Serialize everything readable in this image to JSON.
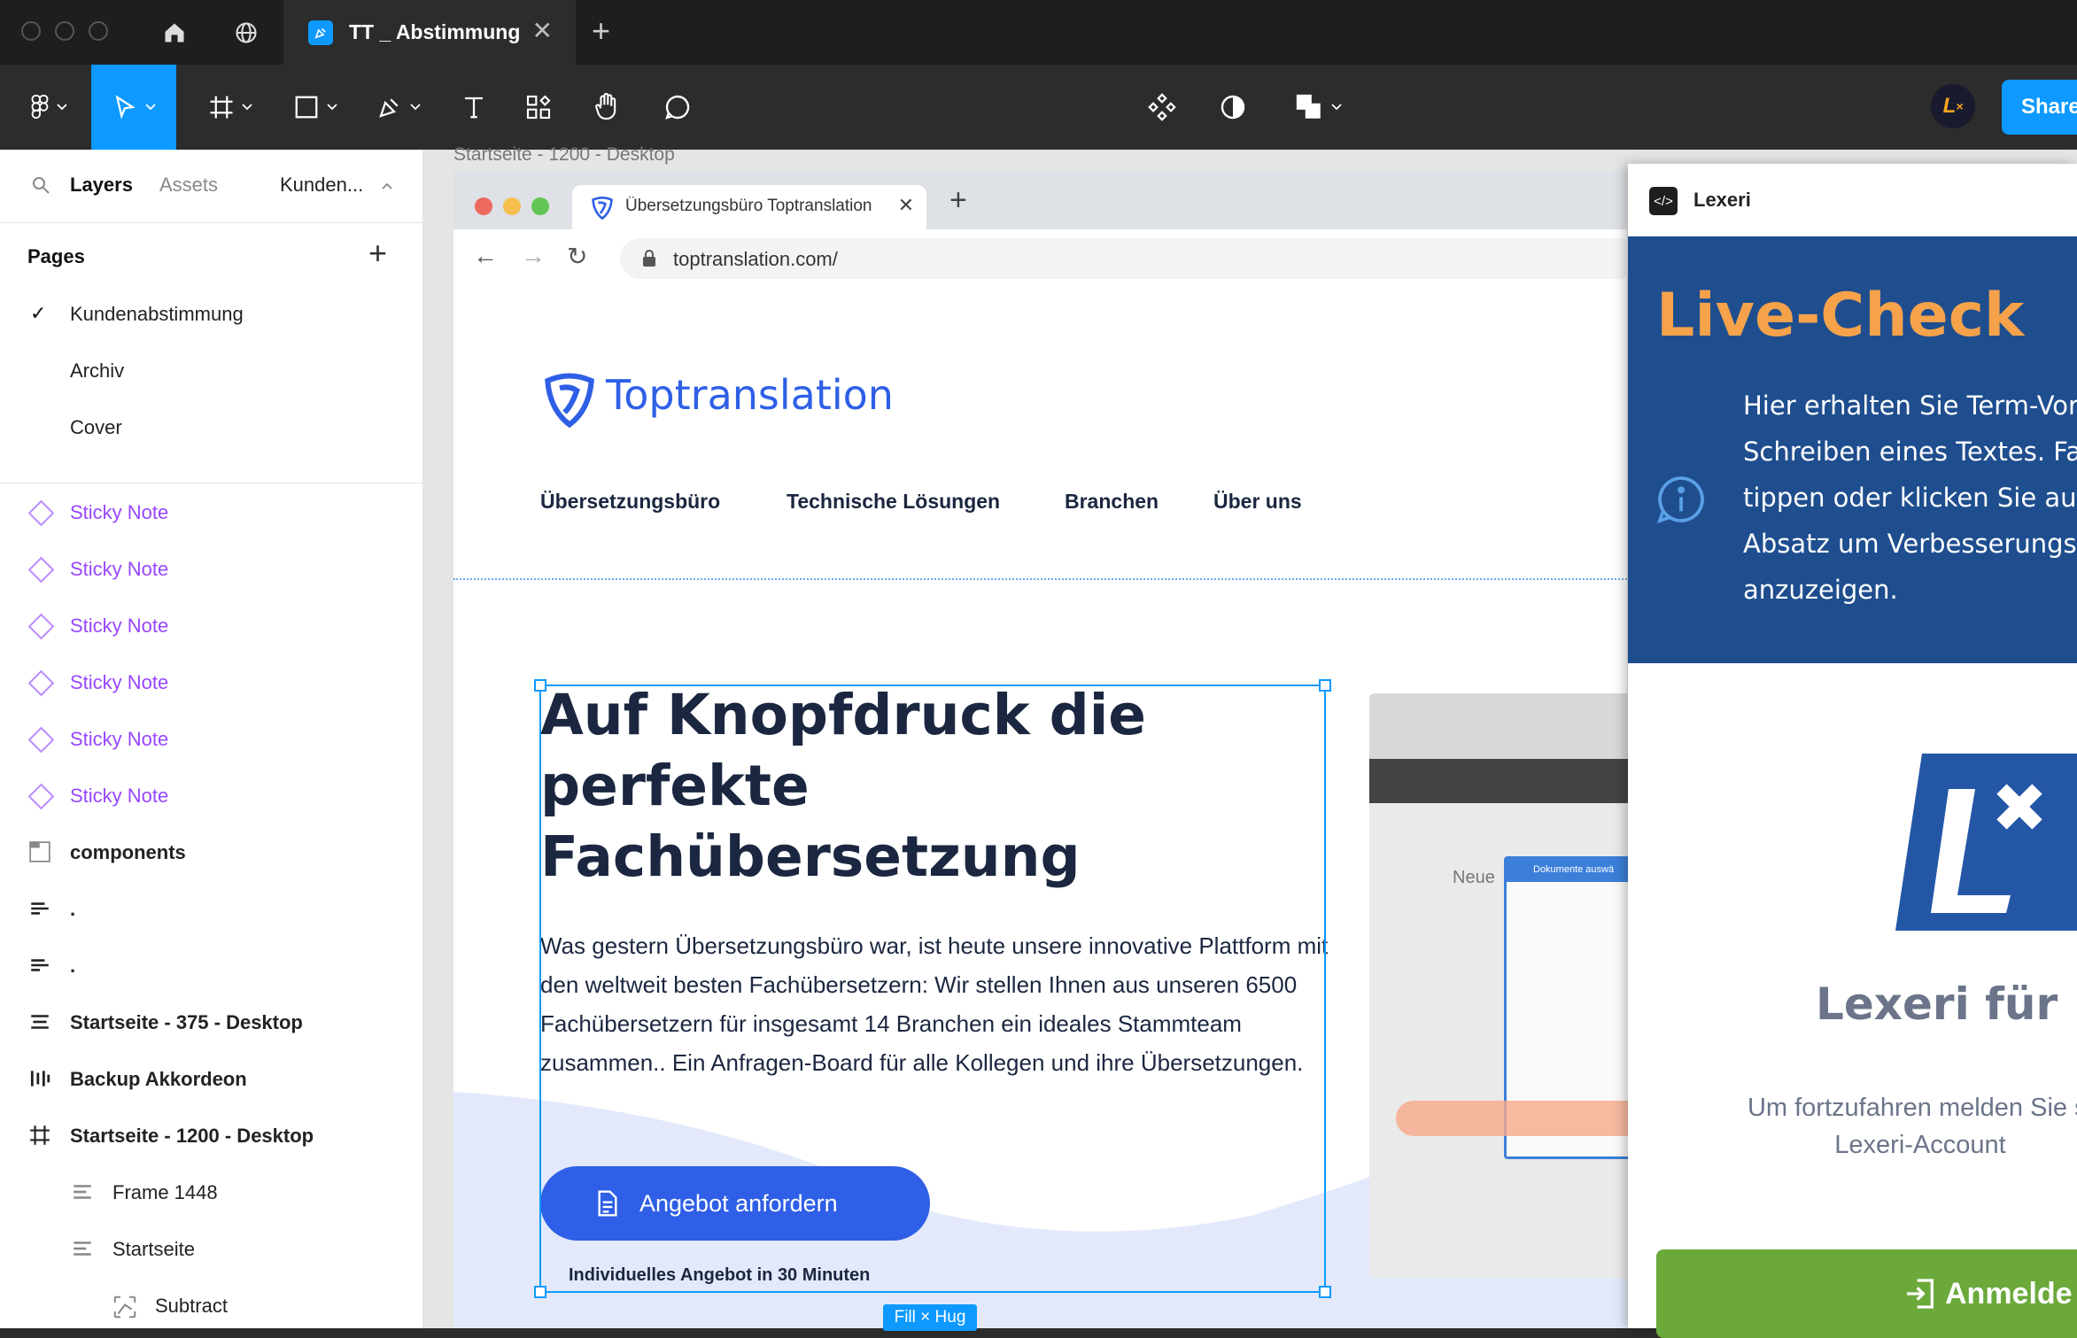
{
  "titlebar": {
    "tab_title": "TT _ Abstimmung"
  },
  "toolbar": {
    "share_label": "Share"
  },
  "left_panel": {
    "tabs": {
      "layers": "Layers",
      "assets": "Assets",
      "page_selector": "Kunden..."
    },
    "pages_header": "Pages",
    "pages": [
      "Kundenabstimmung",
      "Archiv",
      "Cover"
    ],
    "layers": [
      {
        "label": "Sticky Note",
        "icon": "component-diamond-icon"
      },
      {
        "label": "Sticky Note",
        "icon": "component-diamond-icon"
      },
      {
        "label": "Sticky Note",
        "icon": "component-diamond-icon"
      },
      {
        "label": "Sticky Note",
        "icon": "component-diamond-icon"
      },
      {
        "label": "Sticky Note",
        "icon": "component-diamond-icon"
      },
      {
        "label": "Sticky Note",
        "icon": "component-diamond-icon"
      },
      {
        "label": "components",
        "icon": "section-icon"
      },
      {
        "label": ".",
        "icon": "autolayout-vertical-icon"
      },
      {
        "label": ".",
        "icon": "autolayout-vertical-icon"
      },
      {
        "label": "Startseite - 375 - Desktop",
        "icon": "autolayout-vertical-icon"
      },
      {
        "label": "Backup Akkordeon",
        "icon": "autolayout-horizontal-icon"
      },
      {
        "label": "Startseite - 1200 - Desktop",
        "icon": "frame-icon"
      },
      {
        "label": "Frame 1448",
        "icon": "autolayout-vertical-icon"
      },
      {
        "label": "Startseite",
        "icon": "autolayout-vertical-icon"
      },
      {
        "label": "Subtract",
        "icon": "vector-icon"
      }
    ]
  },
  "canvas": {
    "frame_label": "Startseite - 1200 - Desktop",
    "browser": {
      "tab_title": "Übersetzungsbüro Toptranslation",
      "url": "toptranslation.com/"
    },
    "site": {
      "logo_text": "Toptranslation",
      "nav": [
        "Übersetzungsbüro",
        "Technische Lösungen",
        "Branchen",
        "Über uns"
      ],
      "headline": "Auf Knopfdruck die perfekte Fachübersetzung",
      "body": "Was gestern Übersetzungsbüro war, ist heute unsere innovative Plattform mit den weltweit besten Fachübersetzern: Wir stellen Ihnen aus unseren 6500 Fachübersetzern für insgesamt 14 Branchen ein ideales Stammteam zusammen.. Ein Anfragen-Board für alle Kollegen und ihre Übersetzungen.",
      "cta_label": "Angebot anfordern",
      "cta_note": "Individuelles Angebot in 30 Minuten",
      "screenshot_text": "Neue",
      "screenshot_badge": "Dokumente auswä"
    },
    "selection_badge": "Fill × Hug"
  },
  "lexeri": {
    "header": "Lexeri",
    "live_check_title": "Live-Check",
    "info_lines": [
      "Hier erhalten Sie Term-Vor",
      "Schreiben eines Textes. Fa",
      "tippen oder klicken Sie au",
      "Absatz um Verbesserungs",
      "anzuzeigen."
    ],
    "product_title": "Lexeri für F",
    "login_desc_lines": [
      "Um fortzufahren melden Sie si",
      "Lexeri-Account"
    ],
    "login_label": "Anmelde"
  },
  "colors": {
    "figma_blue": "#0d99ff",
    "site_blue": "#2e5fe6",
    "lexeri_blue": "#1f4e8f",
    "lexeri_orange": "#f5a24b",
    "login_green": "#6aa93a"
  }
}
